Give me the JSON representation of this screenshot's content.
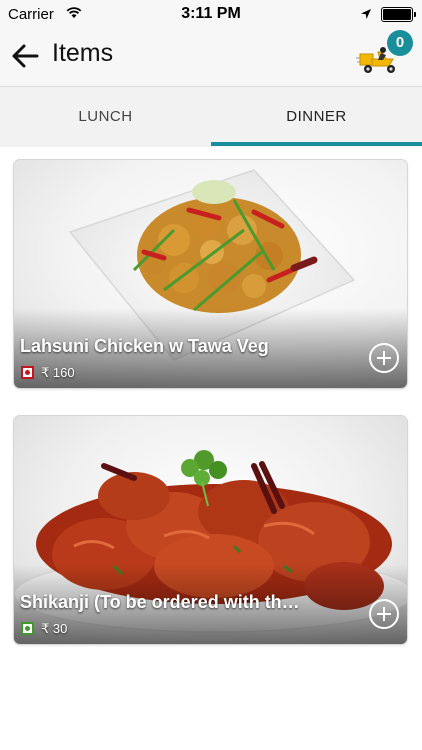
{
  "status_bar": {
    "carrier": "Carrier",
    "time": "3:11 PM"
  },
  "nav": {
    "title": "Items",
    "cart_count": "0"
  },
  "tabs": [
    {
      "label": "LUNCH",
      "selected": false
    },
    {
      "label": "DINNER",
      "selected": true
    }
  ],
  "items": [
    {
      "name": "Lahsuni Chicken w Tawa Veg",
      "price": "₹ 160",
      "type": "non-veg"
    },
    {
      "name": "Shikanji (To be ordered with th…",
      "price": "₹ 30",
      "type": "veg"
    }
  ],
  "colors": {
    "accent": "#1b8e9c",
    "non_veg": "#c4161c",
    "veg": "#3f9a2b"
  }
}
